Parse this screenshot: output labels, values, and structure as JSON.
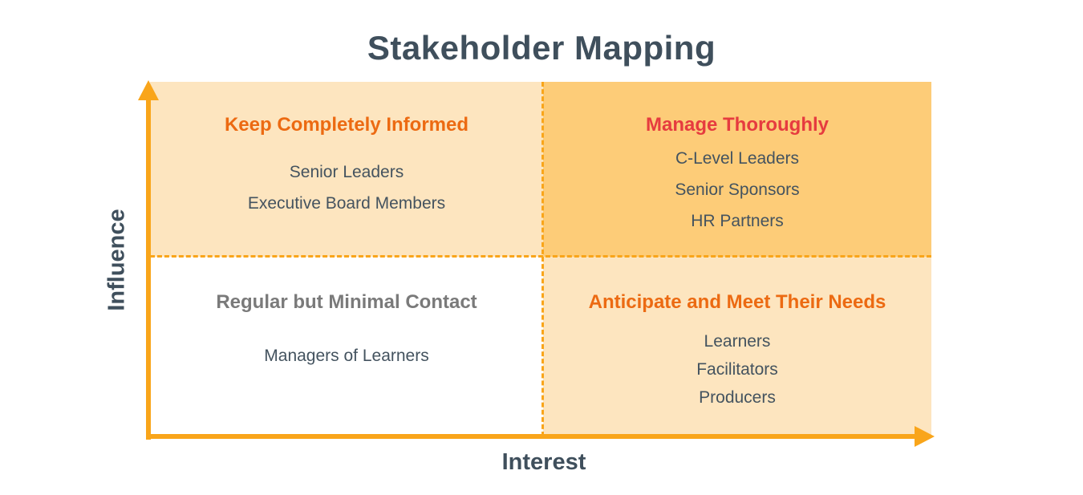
{
  "title": "Stakeholder Mapping",
  "axes": {
    "x_label": "Interest",
    "y_label": "Influence"
  },
  "quadrants": {
    "top_left": {
      "title": "Keep Completely Informed",
      "items": [
        "Senior Leaders",
        "Executive Board Members"
      ]
    },
    "top_right": {
      "title": "Manage Thoroughly",
      "items": [
        "C-Level Leaders",
        "Senior Sponsors",
        "HR Partners"
      ]
    },
    "bottom_left": {
      "title": "Regular but Minimal Contact",
      "items": [
        "Managers of Learners"
      ]
    },
    "bottom_right": {
      "title": "Anticipate and Meet Their Needs",
      "items": [
        "Learners",
        "Facilitators",
        "Producers"
      ]
    }
  },
  "colors": {
    "axis": "#f9a51a",
    "light_fill": "#fde5bf",
    "strong_fill": "#fdcc78",
    "orange_title": "#ec6a12",
    "red_title": "#e63b3f",
    "gray_title": "#7a7a7a",
    "text": "#44535f",
    "heading": "#3f4f5c"
  }
}
